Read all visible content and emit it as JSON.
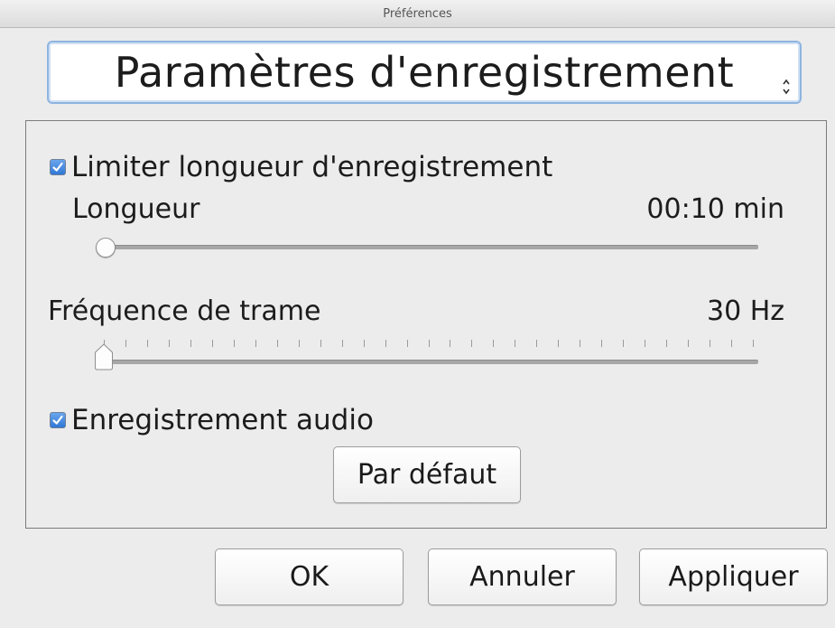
{
  "window": {
    "title": "Préférences"
  },
  "section_popup": {
    "selected": "Paramètres d'enregistrement",
    "icon": "popup-chevrons-icon"
  },
  "limit_recording": {
    "checked": true,
    "label": "Limiter longueur d'enregistrement"
  },
  "length": {
    "label": "Longueur",
    "value_text": "00:10 min",
    "slider_fraction": 0.0
  },
  "frame_rate": {
    "label": "Fréquence de trame",
    "value_text": "30 Hz",
    "slider_fraction": 0.0
  },
  "audio_recording": {
    "checked": true,
    "label": "Enregistrement audio"
  },
  "buttons": {
    "default_label": "Par défaut",
    "ok_label": "OK",
    "cancel_label": "Annuler",
    "apply_label": "Appliquer"
  },
  "colors": {
    "accent": "#2f78d6",
    "focus_ring": "#8fb4e0"
  }
}
